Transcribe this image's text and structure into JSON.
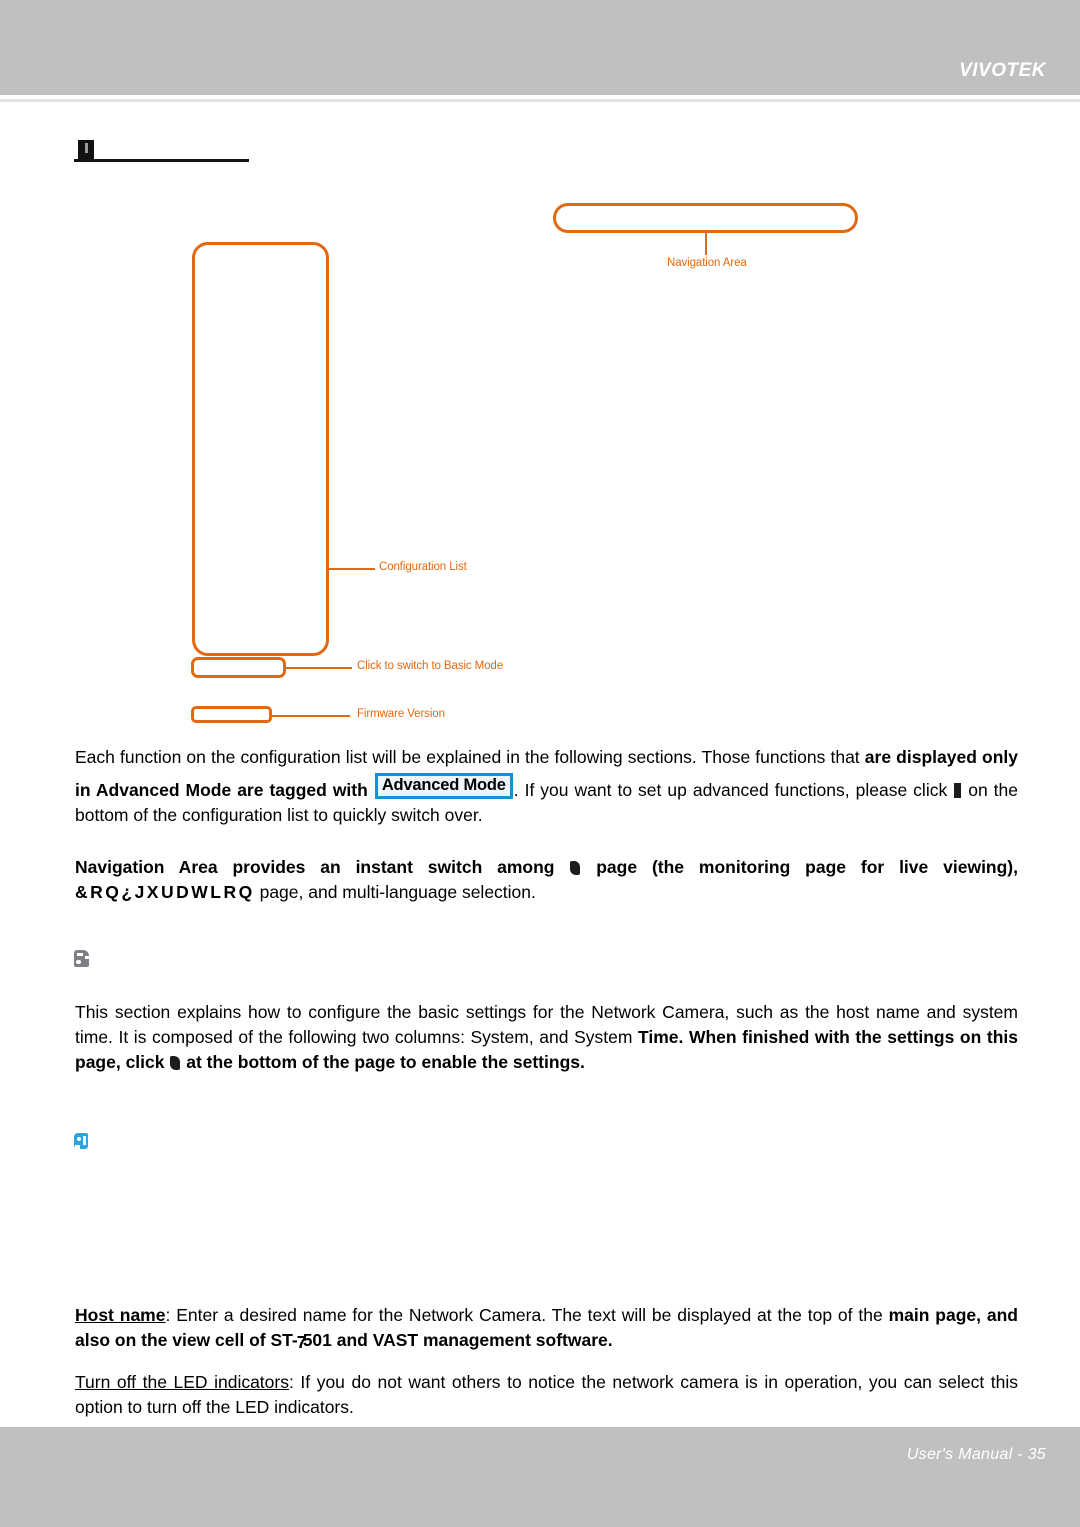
{
  "header": {
    "brand": "VIVOTEK"
  },
  "section_title": {
    "text": ""
  },
  "diagram": {
    "callouts": [
      {
        "id": "navigation-area",
        "label": "Navigation Area"
      },
      {
        "id": "configuration-list",
        "label": "Configuration List"
      },
      {
        "id": "basic-mode",
        "label": "Click to switch to Basic Mode"
      },
      {
        "id": "firmware-version",
        "label": "Firmware Version"
      }
    ],
    "accent_color": "#e2690f"
  },
  "body": {
    "p1": {
      "lead": "Each function on the configuration list will be explained in the following sections. Those functions that ",
      "bold_a": "are displayed only in Advanced Mode are tagged with ",
      "badge": "Advanced Mode",
      "after_badge": ". If you want to set up advanced functions, please click ",
      "tail": " on the bottom of the configuration list to quickly switch over."
    },
    "p2": {
      "bold_a": "Navigation Area provides an instant switch among ",
      "bold_b": " page (the monitoring page for live viewing), ",
      "mangled": "&RQ¿JXUDWLRQ",
      "tail": " page, and multi-language selection."
    },
    "p3": {
      "lead": "This section explains how to configure the basic settings for the Network Camera, such as the host name and system time. It is composed of the following two columns: System, and System ",
      "bold_a": "Time. When finished with the settings on this page, click ",
      "bold_b": " at the bottom of the page to enable the settings."
    },
    "p4": {
      "term": "Host name",
      "lead": ": Enter a desired name for the Network Camera. The text will be displayed at the top of the ",
      "bold_a": "main page, and also on the view cell of ST-",
      "model_digit": "7",
      "bold_b": "501 and VAST management software."
    },
    "p5": {
      "term": "Turn off the LED indicators",
      "lead": ": If you do not want others to notice the network camera is in operation, you can select this option to turn off the LED indicators."
    }
  },
  "footer": {
    "text": "User's Manual - 35"
  }
}
